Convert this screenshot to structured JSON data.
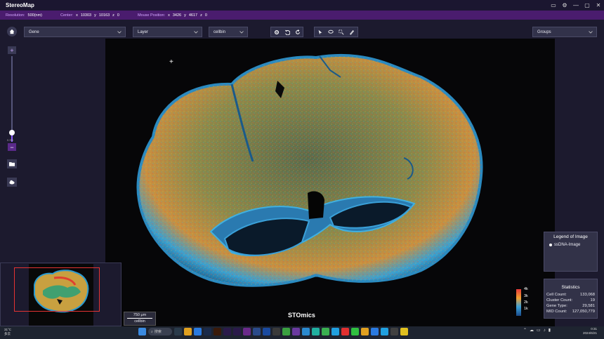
{
  "app": {
    "title": "StereoMap"
  },
  "infobar": {
    "resolution_label": "Resolution:",
    "resolution_value": "500(nm)",
    "center_label": "Center:",
    "center_x_label": "x",
    "center_x": "10303",
    "center_y_label": "y",
    "center_y": "10163",
    "center_z_label": "z",
    "center_z": "0",
    "mouse_label": "Mouse Position:",
    "mouse_x_label": "x",
    "mouse_x": "3426",
    "mouse_y_label": "y",
    "mouse_y": "4617",
    "mouse_z_label": "z",
    "mouse_z": "0"
  },
  "toolbar": {
    "gene_select": "Gene",
    "layer_select": "Layer",
    "bin_select": "cellbin",
    "groups_select": "Groups"
  },
  "zoom": {
    "percent": "0.9%",
    "level": 0.1
  },
  "legend": {
    "title": "Legend of Image",
    "item": "ssDNA-Image"
  },
  "statistics": {
    "title": "Statistics",
    "rows": [
      {
        "label": "Cell Count:",
        "value": "133,068"
      },
      {
        "label": "Cluster Count:",
        "value": "19"
      },
      {
        "label": "Gene Type:",
        "value": "29,581"
      },
      {
        "label": "MID Count:",
        "value": "127,050,779"
      }
    ]
  },
  "colorbar": {
    "labels": [
      "4k",
      "3k",
      "2k",
      "1k"
    ]
  },
  "scale": {
    "length": "750 μm",
    "unit": "cellbin"
  },
  "brand": "STOmics",
  "colors": {
    "accent": "#8a5cff",
    "infobar": "#4a1c6e",
    "panel": "#1c1a2e"
  },
  "taskbar": {
    "weather_temp": "31°C",
    "weather_desc": "多云",
    "search": "搜索",
    "time": "0:31",
    "date": "2024/6/21"
  }
}
